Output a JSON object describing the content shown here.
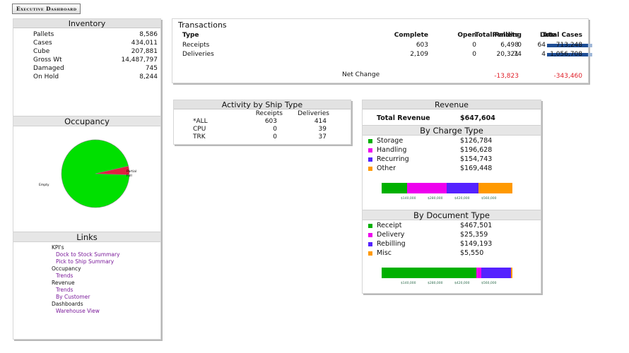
{
  "title": "Executive Dashboard",
  "inventory": {
    "header": "Inventory",
    "rows": [
      {
        "label": "Pallets",
        "value": "8,586"
      },
      {
        "label": "Cases",
        "value": "434,011"
      },
      {
        "label": "Cube",
        "value": "207,881"
      },
      {
        "label": "Gross Wt",
        "value": "14,487,797"
      },
      {
        "label": "Damaged",
        "value": "745"
      },
      {
        "label": "On Hold",
        "value": "8,244"
      }
    ]
  },
  "occupancy": {
    "header": "Occupancy",
    "label_empty": "Empty",
    "label_partial": "Partial",
    "label_full": "Full",
    "colors": {
      "empty": "#00e000",
      "partial": "#e02040"
    }
  },
  "links": {
    "header": "Links",
    "items": [
      {
        "text": "KPI's",
        "sub": false
      },
      {
        "text": "Dock to Stock Summary",
        "sub": true
      },
      {
        "text": "Pick to Ship Summary",
        "sub": true
      },
      {
        "text": "Occupancy",
        "sub": false
      },
      {
        "text": "Trends",
        "sub": true
      },
      {
        "text": "Revenue",
        "sub": false
      },
      {
        "text": "Trends",
        "sub": true
      },
      {
        "text": "By Customer",
        "sub": true
      },
      {
        "text": "Dashboards",
        "sub": false
      },
      {
        "text": "Warehouse View",
        "sub": true
      }
    ]
  },
  "transactions": {
    "header": "Transactions",
    "columns": [
      "Type",
      "Complete",
      "Open",
      "Pending",
      "Late",
      "Total Pallets",
      "Total Cases"
    ],
    "rows": [
      {
        "type": "Receipts",
        "complete": "603",
        "open": "0",
        "pending": "0",
        "late": "64",
        "late_bar": 64,
        "pallets": "6,498",
        "cases": "713,248"
      },
      {
        "type": "Deliveries",
        "complete": "2,109",
        "open": "0",
        "pending": "74",
        "late": "4",
        "late_bar": 64,
        "pallets": "20,321",
        "cases": "1,056,708"
      }
    ],
    "net_label": "Net Change",
    "net_pallets": "-13,823",
    "net_cases": "-343,460"
  },
  "activity": {
    "header": "Activity by Ship Type",
    "columns": [
      "Receipts",
      "Deliveries"
    ],
    "rows": [
      {
        "type": "*ALL",
        "receipts": "603",
        "deliveries": "414"
      },
      {
        "type": "CPU",
        "receipts": "0",
        "deliveries": "39"
      },
      {
        "type": "TRK",
        "receipts": "0",
        "deliveries": "37"
      }
    ]
  },
  "revenue": {
    "header": "Revenue",
    "total_label": "Total Revenue",
    "total_value": "$647,604",
    "charge_header": "By Charge Type",
    "charge_items": [
      {
        "label": "Storage",
        "value": "$126,784",
        "amount": 126784,
        "color": "#00b000"
      },
      {
        "label": "Handling",
        "value": "$196,628",
        "amount": 196628,
        "color": "#ee00ee"
      },
      {
        "label": "Recurring",
        "value": "$154,743",
        "amount": 154743,
        "color": "#5522ff"
      },
      {
        "label": "Other",
        "value": "$169,448",
        "amount": 169448,
        "color": "#ff9900"
      }
    ],
    "doc_header": "By Document Type",
    "doc_items": [
      {
        "label": "Receipt",
        "value": "$467,501",
        "amount": 467501,
        "color": "#00b000"
      },
      {
        "label": "Delivery",
        "value": "$25,359",
        "amount": 25359,
        "color": "#ee00ee"
      },
      {
        "label": "Rebilling",
        "value": "$149,193",
        "amount": 149193,
        "color": "#5522ff"
      },
      {
        "label": "Misc",
        "value": "$5,550",
        "amount": 5550,
        "color": "#ff9900"
      }
    ],
    "axis_ticks": [
      "$140,000",
      "$280,000",
      "$420,000",
      "$560,000"
    ]
  }
}
